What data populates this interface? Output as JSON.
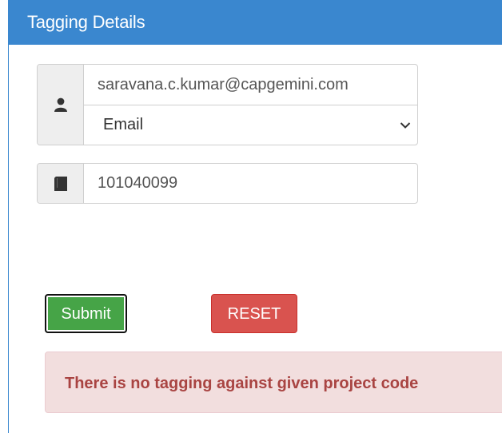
{
  "panel": {
    "title": "Tagging Details"
  },
  "user_group": {
    "icon": "user-icon",
    "email_value": "saravana.c.kumar@capgemini.com",
    "select_value": "Email"
  },
  "project_group": {
    "icon": "book-icon",
    "project_code": "101040099"
  },
  "buttons": {
    "submit_label": "Submit",
    "reset_label": "RESET"
  },
  "alert": {
    "message": "There is no tagging against given project code"
  },
  "colors": {
    "header": "#3a87cf",
    "submit": "#46a447",
    "reset": "#d9534f",
    "alert_bg": "#f2dede",
    "alert_text": "#a94442"
  }
}
